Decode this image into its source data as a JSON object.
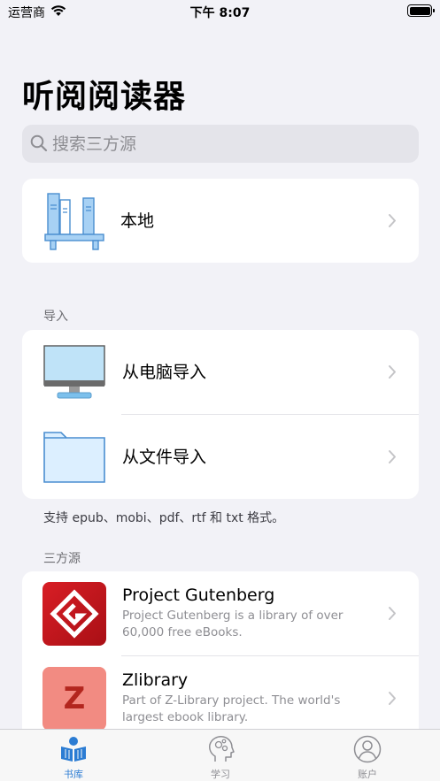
{
  "status_bar": {
    "carrier": "运营商",
    "time": "下午 8:07"
  },
  "page": {
    "title": "听阅阅读器"
  },
  "search": {
    "placeholder": "搜索三方源"
  },
  "local": {
    "label": "本地"
  },
  "import_section": {
    "header": "导入",
    "items": [
      {
        "label": "从电脑导入",
        "icon": "monitor-icon"
      },
      {
        "label": "从文件导入",
        "icon": "folder-icon"
      }
    ],
    "footer": "支持 epub、mobi、pdf、rtf 和 txt 格式。"
  },
  "sources_section": {
    "header": "三方源",
    "items": [
      {
        "title": "Project Gutenberg",
        "description": "Project Gutenberg is a library of over 60,000 free eBooks.",
        "icon": "gutenberg-logo-icon",
        "color": "#c8161d"
      },
      {
        "title": "Zlibrary",
        "description": "Part of Z-Library project. The world's largest ebook library.",
        "icon_letter": "Z",
        "icon": "zlibrary-logo-icon",
        "color": "#f28b82"
      }
    ]
  },
  "tab_bar": {
    "tabs": [
      {
        "label": "书库",
        "icon": "bookshelf-reader-icon",
        "active": true
      },
      {
        "label": "学习",
        "icon": "head-gears-icon",
        "active": false
      },
      {
        "label": "账户",
        "icon": "account-icon",
        "active": false
      }
    ],
    "accent_color": "#2b7cd3"
  }
}
